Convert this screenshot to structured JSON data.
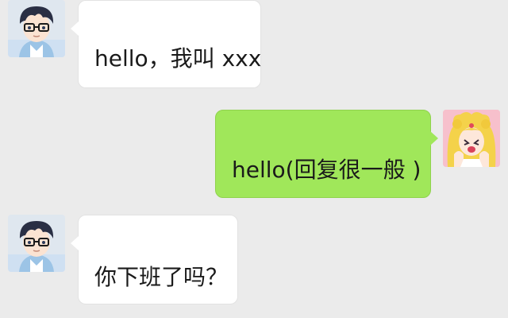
{
  "messages": [
    {
      "side": "left",
      "text": "hello，我叫 xxx",
      "avatar": "boy-glasses-avatar"
    },
    {
      "side": "right",
      "text": "hello(回复很一般 )",
      "avatar": "girl-blonde-avatar"
    },
    {
      "side": "left",
      "text": "你下班了吗？",
      "avatar": "boy-glasses-avatar"
    }
  ],
  "colors": {
    "background": "#ebebeb",
    "incoming_bubble": "#ffffff",
    "outgoing_bubble": "#a0e75a"
  }
}
